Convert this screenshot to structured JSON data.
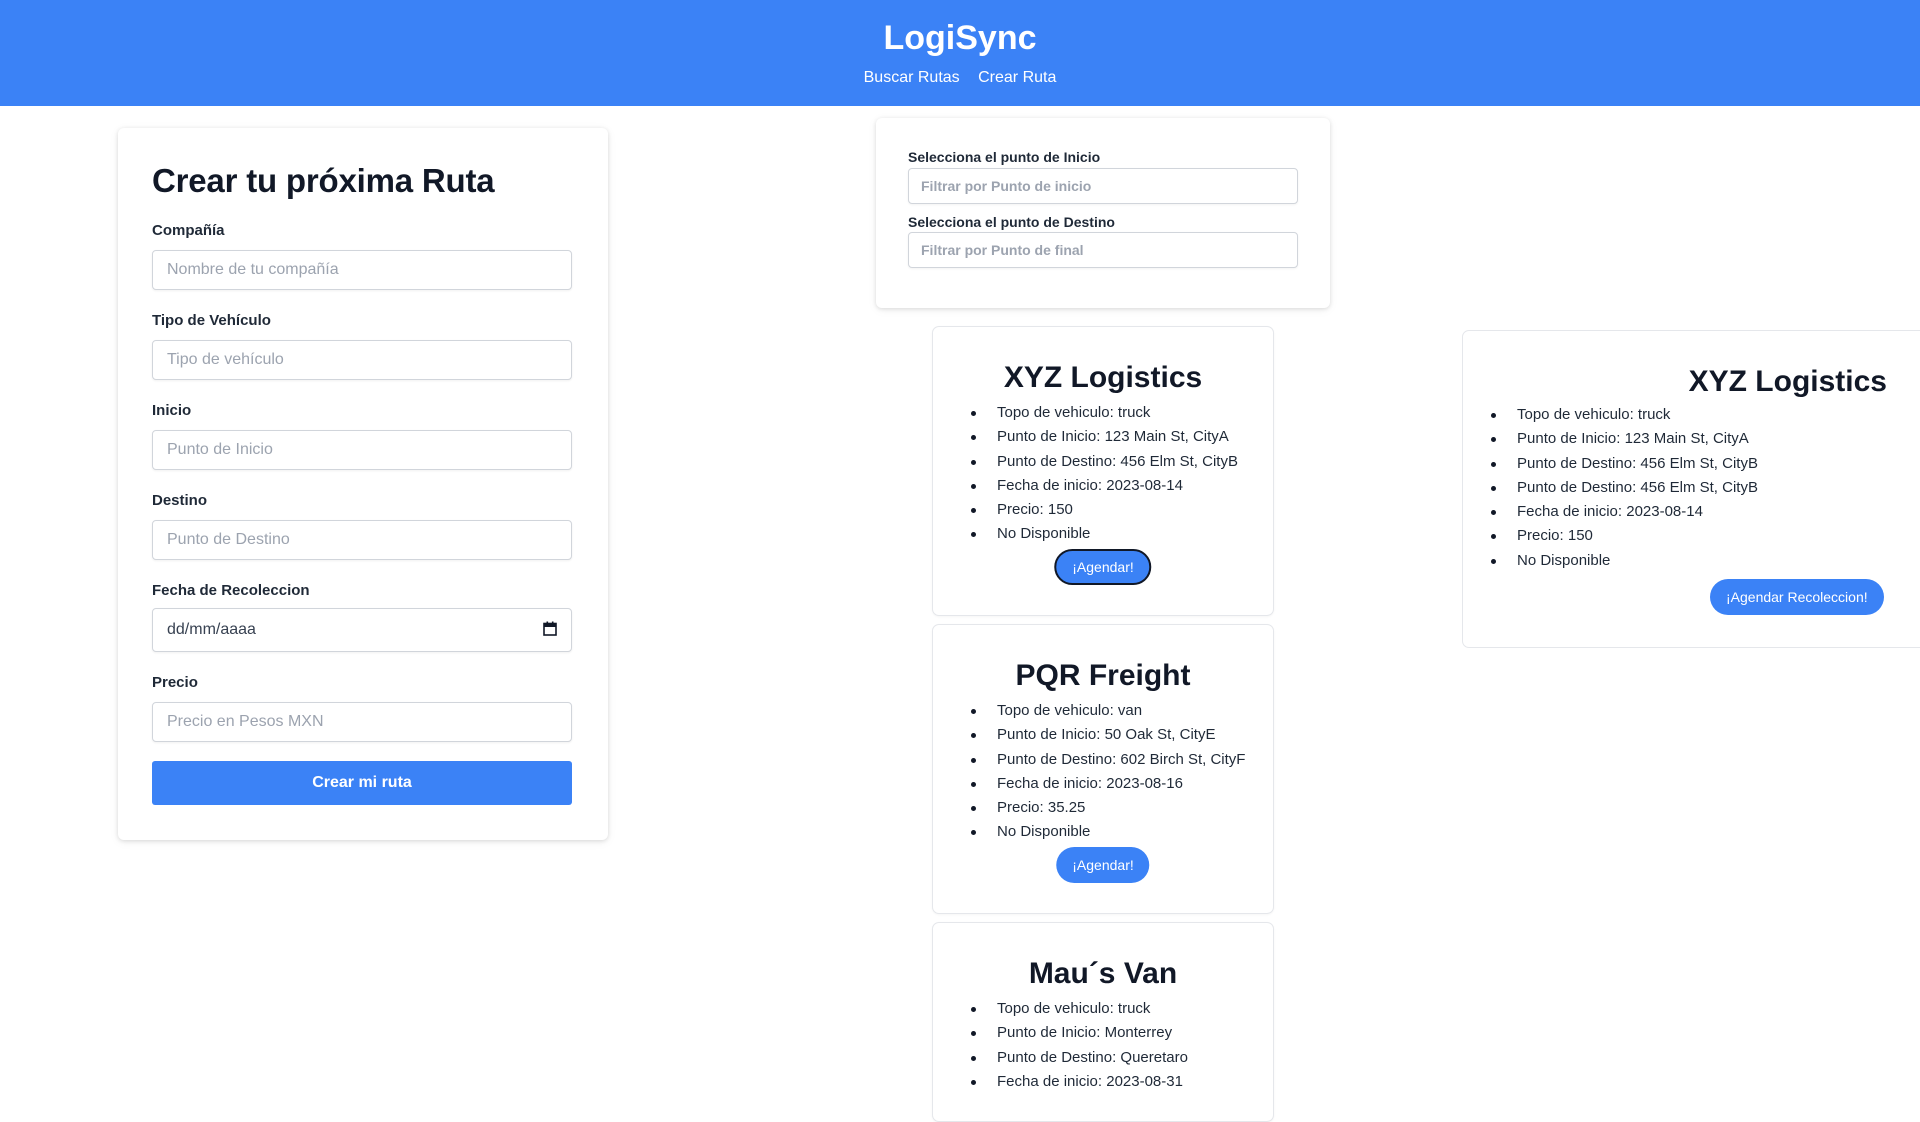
{
  "header": {
    "brand": "LogiSync",
    "nav": [
      "Buscar Rutas",
      "Crear Ruta"
    ]
  },
  "create_form": {
    "title": "Crear tu próxima Ruta",
    "fields": [
      {
        "label": "Compañía",
        "placeholder": "Nombre de tu compañía"
      },
      {
        "label": "Tipo de Vehículo",
        "placeholder": "Tipo de vehículo"
      },
      {
        "label": "Inicio",
        "placeholder": "Punto de Inicio"
      },
      {
        "label": "Destino",
        "placeholder": "Punto de Destino"
      },
      {
        "label": "Fecha de Recoleccion",
        "placeholder": "dd/mm/aaaa"
      },
      {
        "label": "Precio",
        "placeholder": "Precio en Pesos MXN"
      }
    ],
    "submit_label": "Crear mi ruta"
  },
  "filters": {
    "start_label": "Selecciona el punto de Inicio",
    "start_placeholder": "Filtrar por Punto de inicio",
    "end_label": "Selecciona el punto de Destino",
    "end_placeholder": "Filtrar por Punto de final"
  },
  "routes": [
    {
      "company": "XYZ Logistics",
      "details": [
        "Topo de vehiculo: truck",
        "Punto de Inicio: 123 Main St, CityA",
        "Punto de Destino: 456 Elm St, CityB",
        "Fecha de inicio: 2023-08-14",
        "Precio: 150",
        "No Disponible"
      ],
      "button": "¡Agendar!"
    },
    {
      "company": "PQR Freight",
      "details": [
        "Topo de vehiculo: van",
        "Punto de Inicio: 50 Oak St, CityE",
        "Punto de Destino: 602 Birch St, CityF",
        "Fecha de inicio: 2023-08-16",
        "Precio: 35.25",
        "No Disponible"
      ],
      "button": "¡Agendar!"
    },
    {
      "company": "Mau´s Van",
      "details": [
        "Topo de vehiculo: truck",
        "Punto de Inicio: Monterrey",
        "Punto de Destino: Queretaro",
        "Fecha de inicio: 2023-08-31"
      ]
    }
  ],
  "selected_route": {
    "company": "XYZ Logistics",
    "details": [
      "Topo de vehiculo: truck",
      "Punto de Inicio: 123 Main St, CityA",
      "Punto de Destino: 456 Elm St, CityB",
      "Punto de Destino: 456 Elm St, CityB",
      "Fecha de inicio: 2023-08-14",
      "Precio: 150",
      "No Disponible"
    ],
    "button": "¡Agendar Recoleccion!"
  },
  "colors": {
    "primary": "#3b82f6",
    "text": "#111827"
  }
}
